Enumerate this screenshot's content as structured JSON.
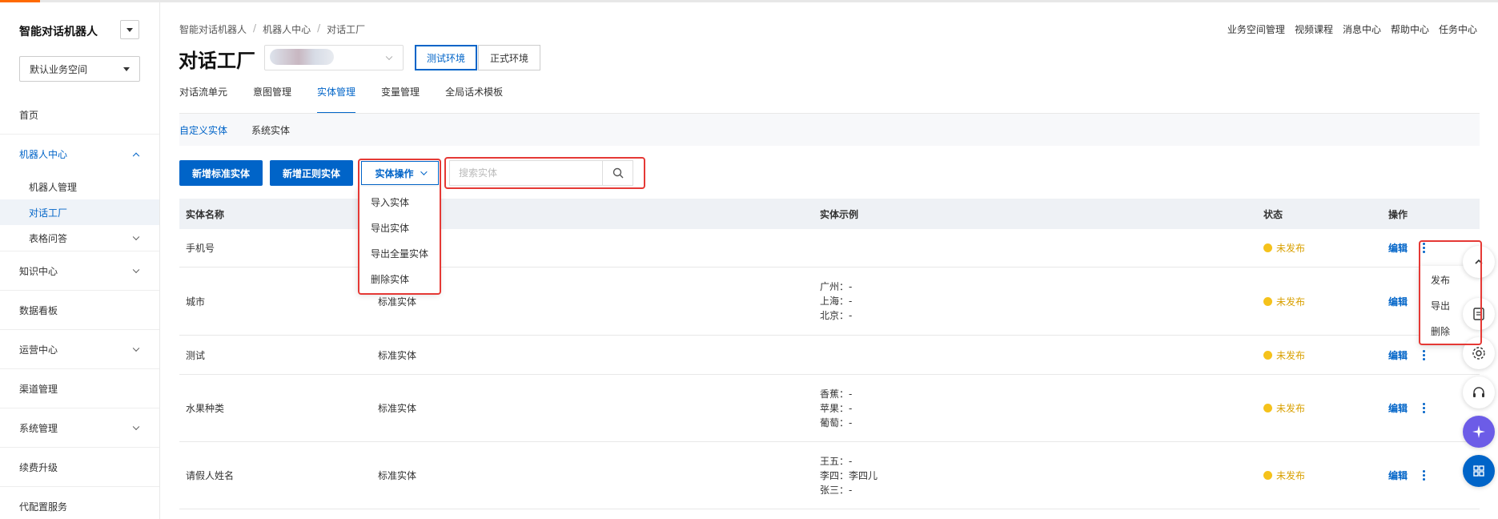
{
  "brand": {
    "title": "智能对话机器人"
  },
  "workspace": {
    "selected": "默认业务空间"
  },
  "sidebar": {
    "items": [
      {
        "label": "首页"
      },
      {
        "label": "机器人中心"
      },
      {
        "label": "机器人管理"
      },
      {
        "label": "对话工厂"
      },
      {
        "label": "表格问答"
      },
      {
        "label": "知识中心"
      },
      {
        "label": "数据看板"
      },
      {
        "label": "运营中心"
      },
      {
        "label": "渠道管理"
      },
      {
        "label": "系统管理"
      },
      {
        "label": "续费升级"
      },
      {
        "label": "代配置服务"
      }
    ]
  },
  "header": {
    "breadcrumb": [
      "智能对话机器人",
      "机器人中心",
      "对话工厂"
    ],
    "breadcrumb_sep": "/",
    "top_links": [
      "业务空间管理",
      "视频课程",
      "消息中心",
      "帮助中心",
      "任务中心"
    ],
    "title": "对话工厂",
    "env_test": "测试环境",
    "env_prod": "正式环境"
  },
  "tabs": [
    "对话流单元",
    "意图管理",
    "实体管理",
    "变量管理",
    "全局话术模板"
  ],
  "subtabs": [
    "自定义实体",
    "系统实体"
  ],
  "toolbar": {
    "add_standard": "新增标准实体",
    "add_regex": "新增正则实体",
    "entity_ops": "实体操作",
    "search_placeholder": "搜索实体"
  },
  "entity_ops_menu": [
    "导入实体",
    "导出实体",
    "导出全量实体",
    "删除实体"
  ],
  "table": {
    "columns": [
      "实体名称",
      "实体示例",
      "状态",
      "操作"
    ],
    "rows": [
      {
        "name": "手机号",
        "type": "",
        "examples": [],
        "status": "未发布",
        "edit": "编辑"
      },
      {
        "name": "城市",
        "type": "标准实体",
        "examples": [
          "广州：-",
          "上海：-",
          "北京：-"
        ],
        "status": "未发布",
        "edit": "编辑"
      },
      {
        "name": "测试",
        "type": "标准实体",
        "examples": [],
        "status": "未发布",
        "edit": "编辑"
      },
      {
        "name": "水果种类",
        "type": "标准实体",
        "examples": [
          "香蕉：-",
          "苹果：-",
          "葡萄：-"
        ],
        "status": "未发布",
        "edit": "编辑"
      },
      {
        "name": "请假人姓名",
        "type": "标准实体",
        "examples": [
          "王五：-",
          "李四：李四儿",
          "张三：-"
        ],
        "status": "未发布",
        "edit": "编辑"
      }
    ]
  },
  "row_menu": [
    "发布",
    "导出",
    "删除"
  ],
  "colors": {
    "accent": "#0064c8",
    "status_dot": "#f5c21b",
    "highlight_frame": "#e53935"
  }
}
